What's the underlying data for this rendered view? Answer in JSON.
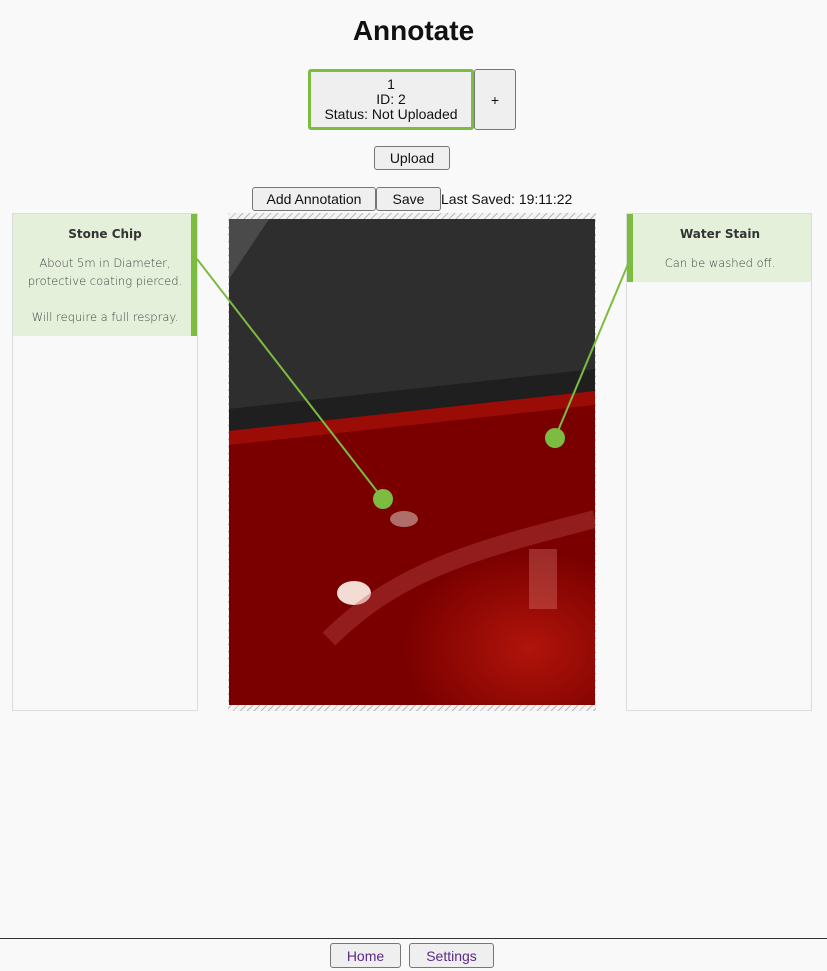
{
  "page": {
    "title": "Annotate"
  },
  "record": {
    "number": "1",
    "id_text": "ID: 2",
    "status_text": "Status: Not Uploaded"
  },
  "add_record_label": "+",
  "upload_label": "Upload",
  "toolbar": {
    "add_annotation_label": "Add Annotation",
    "save_label": "Save",
    "last_saved": "Last Saved: 19:11:22"
  },
  "annotations": {
    "left": {
      "title": "Stone Chip",
      "body_line1": "About 5m in Diameter, protective coating pierced.",
      "body_line2": "Will require a full respray."
    },
    "right": {
      "title": "Water Stain",
      "body": "Can be washed off."
    }
  },
  "colors": {
    "accent": "#7cbc40",
    "note_background": "#e5f0db",
    "nav_text": "#5b2a86"
  },
  "footer": {
    "home_label": "Home",
    "settings_label": "Settings"
  }
}
